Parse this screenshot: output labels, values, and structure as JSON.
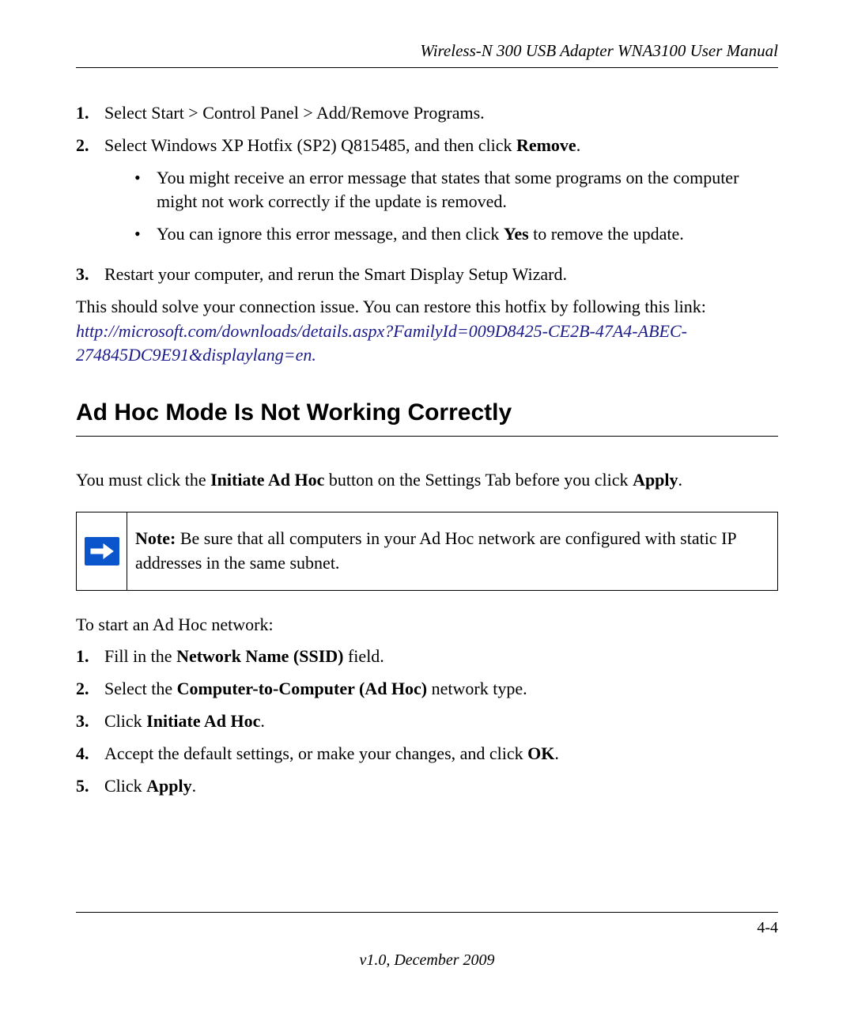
{
  "header": {
    "manual_title": "Wireless-N 300 USB Adapter WNA3100 User Manual"
  },
  "list1": {
    "item1_num": "1.",
    "item1_text": "Select Start > Control Panel > Add/Remove Programs.",
    "item2_num": "2.",
    "item2_text_pre": "Select Windows XP Hotfix (SP2) Q815485, and then click ",
    "item2_bold": "Remove",
    "item2_text_post": ".",
    "sub1_text": "You might receive an error message that states that some programs on the computer might not work correctly if the update is removed.",
    "sub2_text_pre": "You can ignore this error message, and then click ",
    "sub2_bold": "Yes",
    "sub2_text_post": " to remove the update.",
    "item3_num": "3.",
    "item3_text": "Restart your computer, and rerun the Smart Display Setup Wizard."
  },
  "para_after": {
    "text": "This should solve your connection issue. You can restore this hotfix by following this link: ",
    "link": "http://microsoft.com/downloads/details.aspx?FamilyId=009D8425-CE2B-47A4-ABEC-274845DC9E91&displaylang=en",
    "period": "."
  },
  "section_heading": "Ad Hoc Mode Is Not Working Correctly",
  "para2": {
    "pre": "You must click the ",
    "b1": "Initiate Ad Hoc",
    "mid": " button on the Settings Tab before you click ",
    "b2": "Apply",
    "post": "."
  },
  "note": {
    "label": "Note:",
    "text": " Be sure that all computers in your Ad Hoc network are configured with static IP addresses in the same subnet."
  },
  "para3": "To start an Ad Hoc network:",
  "list2": {
    "item1_num": "1.",
    "item1_pre": "Fill in the ",
    "item1_b": "Network Name (SSID)",
    "item1_post": " field.",
    "item2_num": "2.",
    "item2_pre": "Select the ",
    "item2_b": "Computer-to-Computer (Ad Hoc)",
    "item2_post": " network type.",
    "item3_num": "3.",
    "item3_pre": "Click ",
    "item3_b": "Initiate Ad Hoc",
    "item3_post": ".",
    "item4_num": "4.",
    "item4_pre": "Accept the default settings, or make your changes, and click ",
    "item4_b": "OK",
    "item4_post": ".",
    "item5_num": "5.",
    "item5_pre": "Click ",
    "item5_b": "Apply",
    "item5_post": "."
  },
  "footer": {
    "page_num": "4-4",
    "version": "v1.0, December 2009"
  }
}
